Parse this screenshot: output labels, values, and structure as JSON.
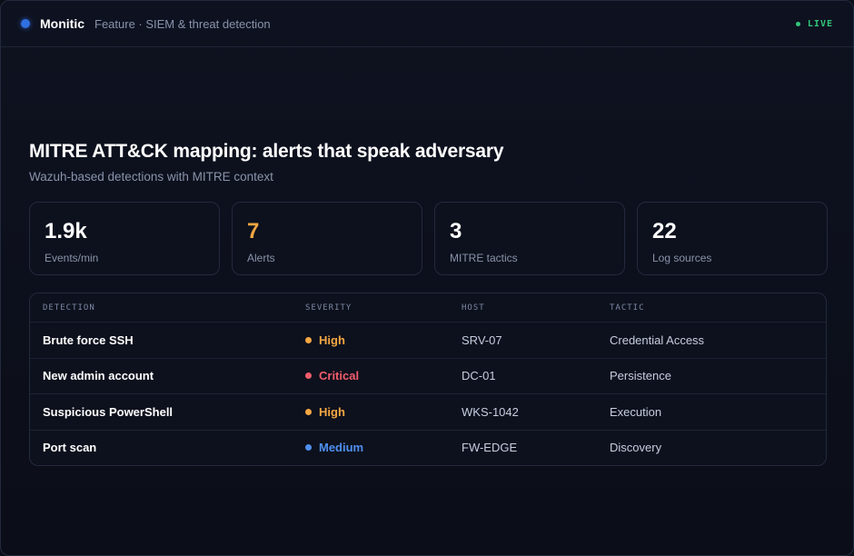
{
  "header": {
    "brand": "Monitic",
    "breadcrumb": "Feature · SIEM & threat detection",
    "status": "LIVE"
  },
  "heading": {
    "title": "MITRE ATT&CK mapping: alerts that speak adversary",
    "subtitle": "Wazuh-based detections with MITRE context"
  },
  "stats": [
    {
      "value": "1.9k",
      "label": "Events/min"
    },
    {
      "value": "7",
      "label": "Alerts"
    },
    {
      "value": "3",
      "label": "MITRE tactics"
    },
    {
      "value": "22",
      "label": "Log sources"
    }
  ],
  "table": {
    "columns": [
      "DETECTION",
      "SEVERITY",
      "HOST",
      "TACTIC"
    ],
    "rows": [
      {
        "detection": "Brute force SSH",
        "severity": "High",
        "host": "SRV-07",
        "tactic": "Credential Access"
      },
      {
        "detection": "New admin account",
        "severity": "Critical",
        "host": "DC-01",
        "tactic": "Persistence"
      },
      {
        "detection": "Suspicious PowerShell",
        "severity": "High",
        "host": "WKS-1042",
        "tactic": "Execution"
      },
      {
        "detection": "Port scan",
        "severity": "Medium",
        "host": "FW-EDGE",
        "tactic": "Discovery"
      }
    ]
  },
  "colors": {
    "brand": "#2f6fe0",
    "live": "#32c77a",
    "alerts_accent": "#f5a742",
    "severity_high": "#f5a742",
    "severity_critical": "#f25c6b",
    "severity_medium": "#4f8ff0"
  }
}
